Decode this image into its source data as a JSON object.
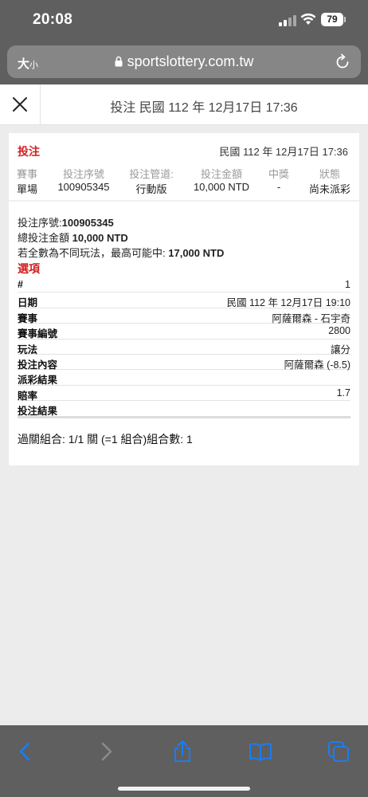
{
  "status_bar": {
    "time": "20:08",
    "battery": "79"
  },
  "browser": {
    "aa_label": "大",
    "aa_small": "小",
    "url": "sportslottery.com.tw"
  },
  "header": {
    "title": "投注 民國 112 年 12月17日 17:36"
  },
  "bet": {
    "label": "投注",
    "date": "民國 112 年 12月17日 17:36",
    "columns": [
      {
        "header": "賽事",
        "value": "單場"
      },
      {
        "header": "投注序號",
        "value": "100905345"
      },
      {
        "header": "投注管道:",
        "value": "行動版"
      },
      {
        "header": "投注金額",
        "value": "10,000 NTD"
      },
      {
        "header": "中獎",
        "value": "-"
      },
      {
        "header": "狀態",
        "value": "尚未派彩"
      }
    ],
    "serial_label": "投注序號:",
    "serial_value": "100905345",
    "total_label": "總投注金額",
    "total_value": "10,000 NTD",
    "max_label": "若全數為不同玩法，最高可能中:",
    "max_value": "17,000 NTD"
  },
  "options": {
    "title": "選項",
    "rows": [
      {
        "key": "#",
        "value": "1"
      },
      {
        "key": "日期",
        "value": "民國 112 年 12月17日 19:10"
      },
      {
        "key": "賽事",
        "value": "阿薩爾森 - 石宇奇"
      },
      {
        "key": "賽事編號",
        "value": "2800"
      },
      {
        "key": "玩法",
        "value": "讓分"
      },
      {
        "key": "投注內容",
        "value": "阿薩爾森 (-8.5)"
      },
      {
        "key": "派彩結果",
        "value": ""
      },
      {
        "key": "賠率",
        "value": "1.7"
      },
      {
        "key": "投注結果",
        "value": ""
      }
    ]
  },
  "parlay": "過關組合: 1/1 關 (=1 組合)組合數: 1",
  "colors": {
    "accent_red": "#d21f1f",
    "safari_gray": "#5f5f5f",
    "ios_blue": "#1a7cf5"
  }
}
